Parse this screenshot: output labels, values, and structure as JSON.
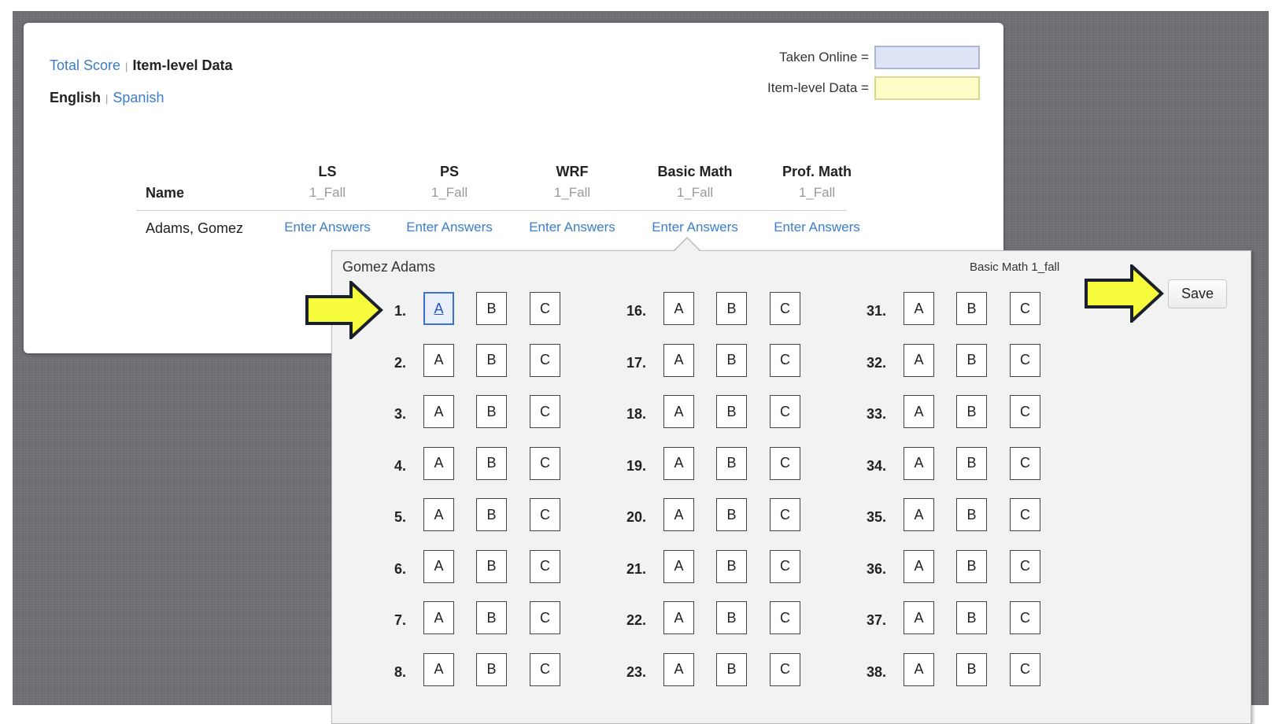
{
  "nav": {
    "total_score": "Total Score",
    "separator": "|",
    "item_level": "Item-level Data",
    "english": "English",
    "spanish": "Spanish"
  },
  "legend": {
    "taken_online": "Taken Online =",
    "item_level": "Item-level Data ="
  },
  "table": {
    "name_header": "Name",
    "columns": [
      {
        "title": "LS",
        "sub": "1_Fall",
        "action": "Enter Answers"
      },
      {
        "title": "PS",
        "sub": "1_Fall",
        "action": "Enter Answers"
      },
      {
        "title": "WRF",
        "sub": "1_Fall",
        "action": "Enter Answers"
      },
      {
        "title": "Basic Math",
        "sub": "1_Fall",
        "action": "Enter Answers"
      },
      {
        "title": "Prof. Math",
        "sub": "1_Fall",
        "action": "Enter Answers"
      }
    ],
    "row_name": "Adams, Gomez"
  },
  "popup": {
    "student": "Gomez Adams",
    "test": "Basic Math 1_fall",
    "save_label": "Save",
    "options": [
      "A",
      "B",
      "C"
    ],
    "selected": {
      "question": 1,
      "option": "A"
    },
    "columns": [
      [
        "1.",
        "2.",
        "3.",
        "4.",
        "5.",
        "6.",
        "7.",
        "8."
      ],
      [
        "16.",
        "17.",
        "18.",
        "19.",
        "20.",
        "21.",
        "22.",
        "23."
      ],
      [
        "31.",
        "32.",
        "33.",
        "34.",
        "35.",
        "36.",
        "37.",
        "38."
      ]
    ]
  },
  "colors": {
    "link": "#3a7dc9",
    "arrow_fill": "#f6fb3c",
    "online_swatch": "#dde4f6",
    "item_swatch": "#fdfdc8"
  }
}
